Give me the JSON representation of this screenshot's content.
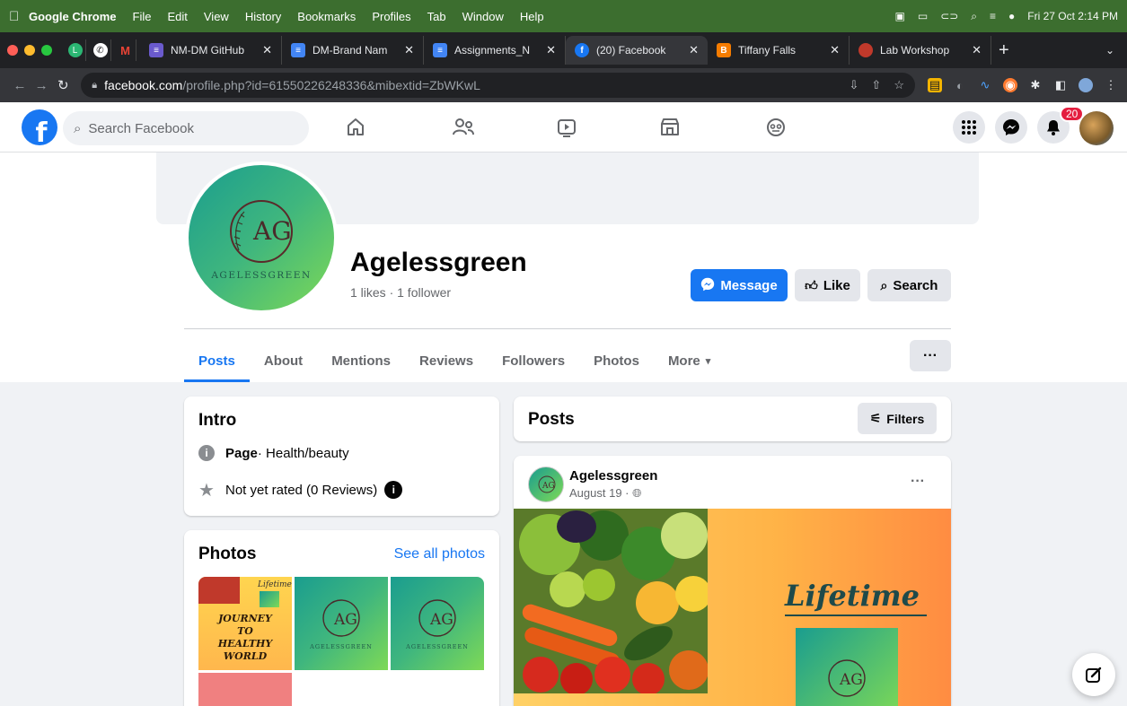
{
  "menubar": {
    "app": "Google Chrome",
    "items": [
      "File",
      "Edit",
      "View",
      "History",
      "Bookmarks",
      "Profiles",
      "Tab",
      "Window",
      "Help"
    ],
    "clock": "Fri 27 Oct  2:14 PM"
  },
  "tabs": [
    {
      "label": "NM-DM GitHub",
      "color": "#6a5acd",
      "icon": "doc-icon"
    },
    {
      "label": "DM-Brand Nam",
      "color": "#4285f4",
      "icon": "docs-icon"
    },
    {
      "label": "Assignments_N",
      "color": "#4285f4",
      "icon": "docs-icon"
    },
    {
      "label": "(20) Facebook",
      "color": "#1877f2",
      "icon": "facebook-icon",
      "active": true
    },
    {
      "label": "Tiffany Falls",
      "color": "#f57c00",
      "icon": "blogger-icon"
    },
    {
      "label": "Lab Workshop",
      "color": "#c0392b",
      "icon": "site-icon"
    }
  ],
  "address": {
    "host": "facebook.com",
    "path": "/profile.php?id=61550226248336&mibextid=ZbWKwL"
  },
  "fb": {
    "search_placeholder": "Search Facebook",
    "notifications": "20"
  },
  "profile": {
    "name": "Agelessgreen",
    "stats": "1 likes · 1 follower",
    "logo_initials": "AG",
    "logo_caption": "AGELESSGREEN",
    "buttons": {
      "message": "Message",
      "like": "Like",
      "search": "Search"
    },
    "tabs": [
      "Posts",
      "About",
      "Mentions",
      "Reviews",
      "Followers",
      "Photos",
      "More"
    ],
    "more_caret": "▾",
    "ellipsis": "···"
  },
  "intro": {
    "title": "Intro",
    "page_label": "Page",
    "page_category": " · Health/beauty",
    "rating": "Not yet rated (0 Reviews)"
  },
  "photos": {
    "title": "Photos",
    "see_all": "See all photos",
    "poster_lines": [
      "JOURNEY",
      "TO",
      "HEALTHY",
      "WORLD"
    ],
    "poster_script": "Lifetime"
  },
  "posts": {
    "title": "Posts",
    "filters": "Filters",
    "post": {
      "author": "Agelessgreen",
      "date": "August 19 · ",
      "script_text": "Lifetime"
    }
  },
  "colors": {
    "fb_blue": "#1877f2",
    "menubar_green": "#3c6e2f",
    "brand_green": "#3fb67e"
  }
}
